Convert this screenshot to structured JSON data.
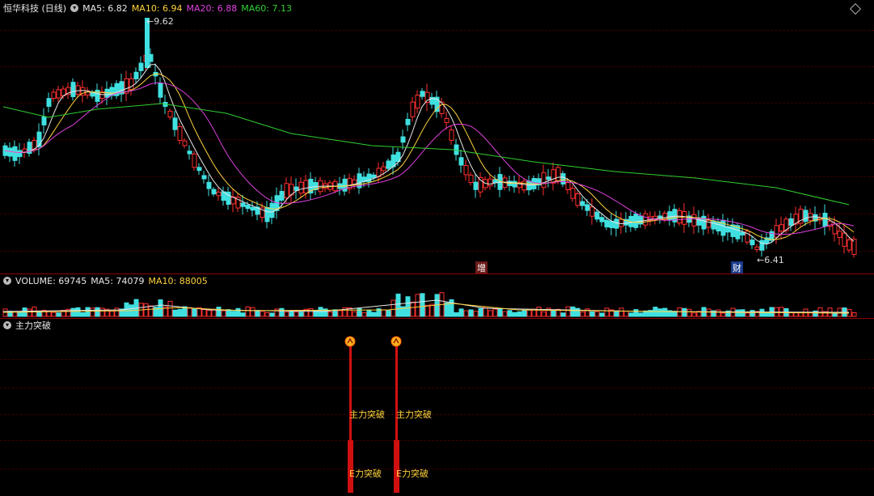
{
  "price_panel": {
    "stock_title": "恒华科技 (日线)",
    "ma5": "MA5: 6.82",
    "ma10": "MA10: 6.94",
    "ma20": "MA20: 6.88",
    "ma60": "MA60: 7.13",
    "high_marker": "9.62",
    "low_marker": "6.41",
    "event_marker_1": "增",
    "event_marker_2": "财"
  },
  "volume_panel": {
    "volume": "VOLUME: 69745",
    "ma5": "MA5: 74079",
    "ma10": "MA10: 88005"
  },
  "indicator_panel": {
    "title": "主力突破",
    "signal_label": "主力突破",
    "signal_label_bottom": "E力突破"
  },
  "colors": {
    "up": "#ff3030",
    "down": "#40e0e0",
    "ma5": "#e8e8e8",
    "ma10": "#ffd23c",
    "ma20": "#e040e0",
    "ma60": "#30d030",
    "grid": "#8b0000"
  }
}
